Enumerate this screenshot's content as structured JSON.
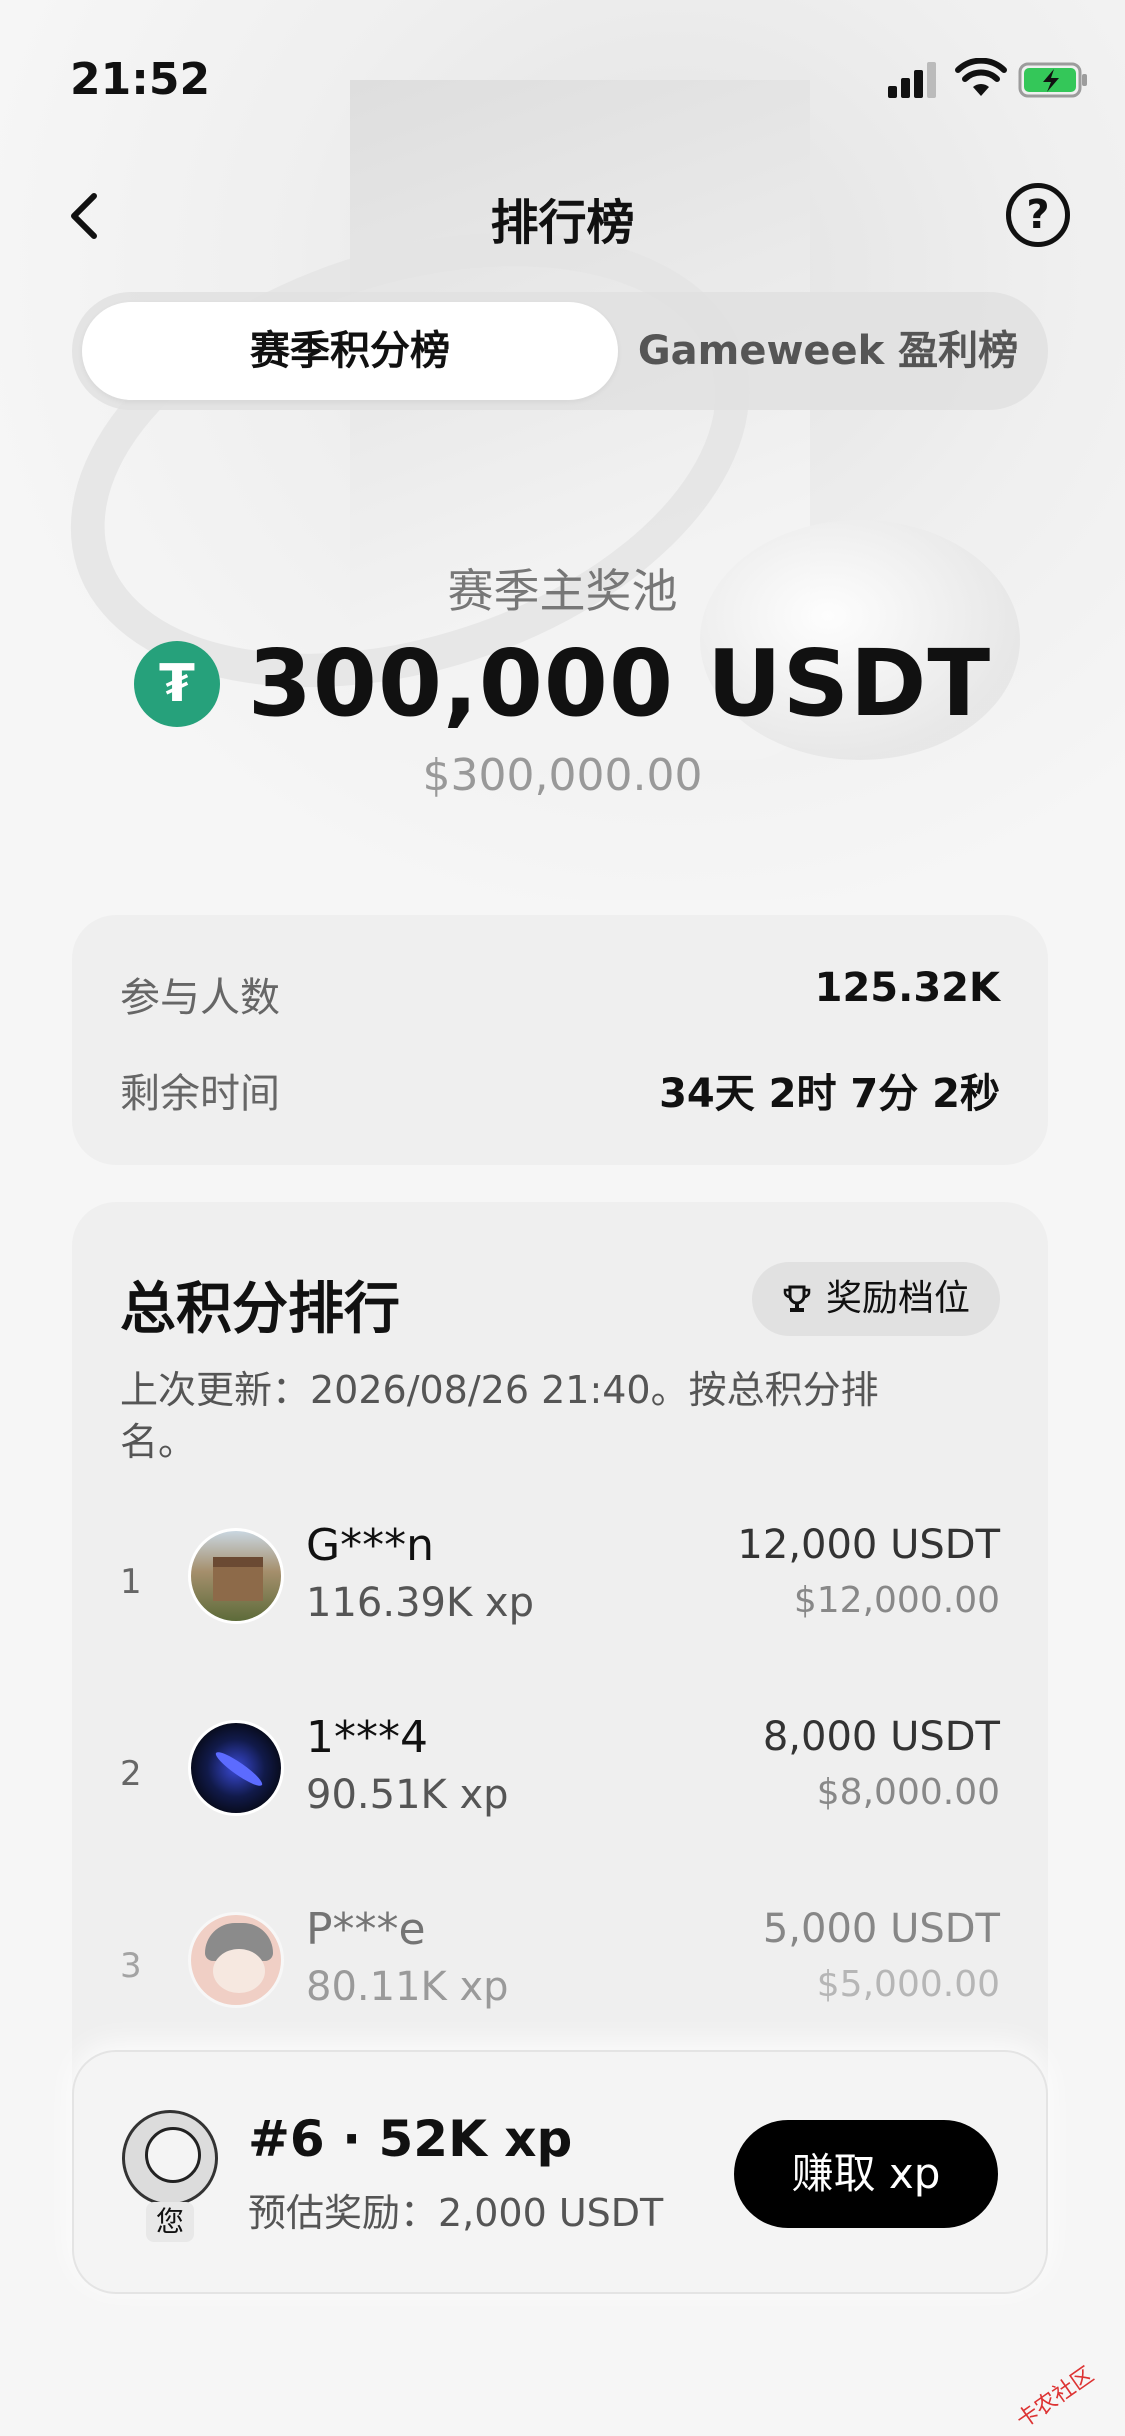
{
  "status_bar": {
    "time": "21:52"
  },
  "header": {
    "title": "排行榜",
    "help_icon": "help-circle-icon",
    "back_icon": "chevron-left-icon"
  },
  "tabs": [
    {
      "label": "赛季积分榜",
      "active": true
    },
    {
      "label": "Gameweek 盈利榜",
      "active": false
    }
  ],
  "prize_pool": {
    "label": "赛季主奖池",
    "amount": "300,000 USDT",
    "fiat": "$300,000.00",
    "token_glyph": "₮",
    "token_color": "#26a17b"
  },
  "stats": {
    "participants_label": "参与人数",
    "participants_value": "125.32K",
    "remaining_label": "剩余时间",
    "remaining_value": "34天 2时 7分 2秒"
  },
  "ranking": {
    "title": "总积分排行",
    "reward_tiers_label": "奖励档位",
    "update_note": "上次更新：2026/08/26 21:40。按总积分排名。",
    "rows": [
      {
        "rank": "1",
        "name": "G***n",
        "xp": "116.39K xp",
        "prize": "12,000 USDT",
        "fiat": "$12,000.00"
      },
      {
        "rank": "2",
        "name": "1***4",
        "xp": "90.51K xp",
        "prize": "8,000 USDT",
        "fiat": "$8,000.00"
      },
      {
        "rank": "3",
        "name": "P***e",
        "xp": "80.11K xp",
        "prize": "5,000 USDT",
        "fiat": "$5,000.00"
      }
    ]
  },
  "me": {
    "tag": "您",
    "rank_xp": "#6 · 52K xp",
    "reward": "预估奖励：2,000 USDT",
    "earn_label": "赚取 xp"
  },
  "watermark": "卡农社区"
}
